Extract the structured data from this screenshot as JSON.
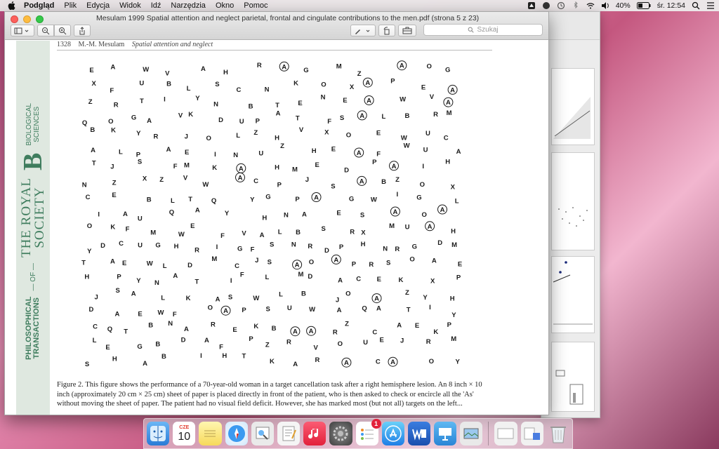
{
  "menubar": {
    "app_name": "Podgląd",
    "items": [
      "Plik",
      "Edycja",
      "Widok",
      "Idź",
      "Narzędzia",
      "Okno",
      "Pomoc"
    ],
    "battery": "40%",
    "clock": "śr. 12:54"
  },
  "window": {
    "title": "Mesulam 1999 Spatial attention and neglect parietal, frontal and cingulate contributions to the men.pdf (strona 5 z 23)",
    "search_placeholder": "Szukaj"
  },
  "document": {
    "page_number": "1328",
    "page_author": "M.-M. Mesulam",
    "page_running_title": "Spatial attention and neglect",
    "spine": {
      "publisher_top": "PHILOSOPHICAL",
      "publisher_mid": "TRANSACTIONS",
      "of": "— OF —",
      "society_line1": "THE ROYAL",
      "society_line2": "SOCIETY",
      "section_letter": "B",
      "section_line1": "BIOLOGICAL",
      "section_line2": "SCIENCES"
    },
    "caption": "Figure 2. This figure shows the performance of a 70-year-old woman in a target cancellation task after a right hemisphere lesion. An 8 inch × 10 inch (approximately 20 cm × 25 cm) sheet of paper is placed directly in front of the patient, who is then asked to check or encircle all the 'As' without moving the sheet of paper. The patient had no visual field deficit. However, she has marked most (but not all) targets on the left..."
  },
  "letter_rows": [
    "E A W V A H R A G M Z A O G",
    "X F U B L S C N K O X A P E A",
    "Z R T I Y N B T E N E A W V A",
    "Q O G A V K D U P A T F S A L B R M",
    "B K Y R J O L Z H V X O E W U C",
    "A L P A E I N U Z H E A F W U A",
    "T J S F M K A H M E D P A I H",
    "N Z X Z V W A C P J S A B Z O X",
    "C E B L T Q Y G P A G W I G L",
    "I A U Q A Y H N A E S A O A",
    "O K F M W E F V A L B S R X M U A H",
    "Y D C U G H R I G F S N R D P H N R G D M",
    "T A E W L D M C J S A O A P R S O A E",
    "H P Y N A T I F L M D A C E K X P",
    "J S A L K A S W L B J O A Z Y H",
    "D A E W F O A P S U W A Q A T I Y",
    "C Q T B N A R E K B A A R Z C A E K P",
    "L E G B D A F P Z R V O U E J R M",
    "S H A B I H T K A R A C A O Y"
  ],
  "dock": {
    "calendar_month": "CZE",
    "calendar_day": "10",
    "notes_badge": "1"
  }
}
